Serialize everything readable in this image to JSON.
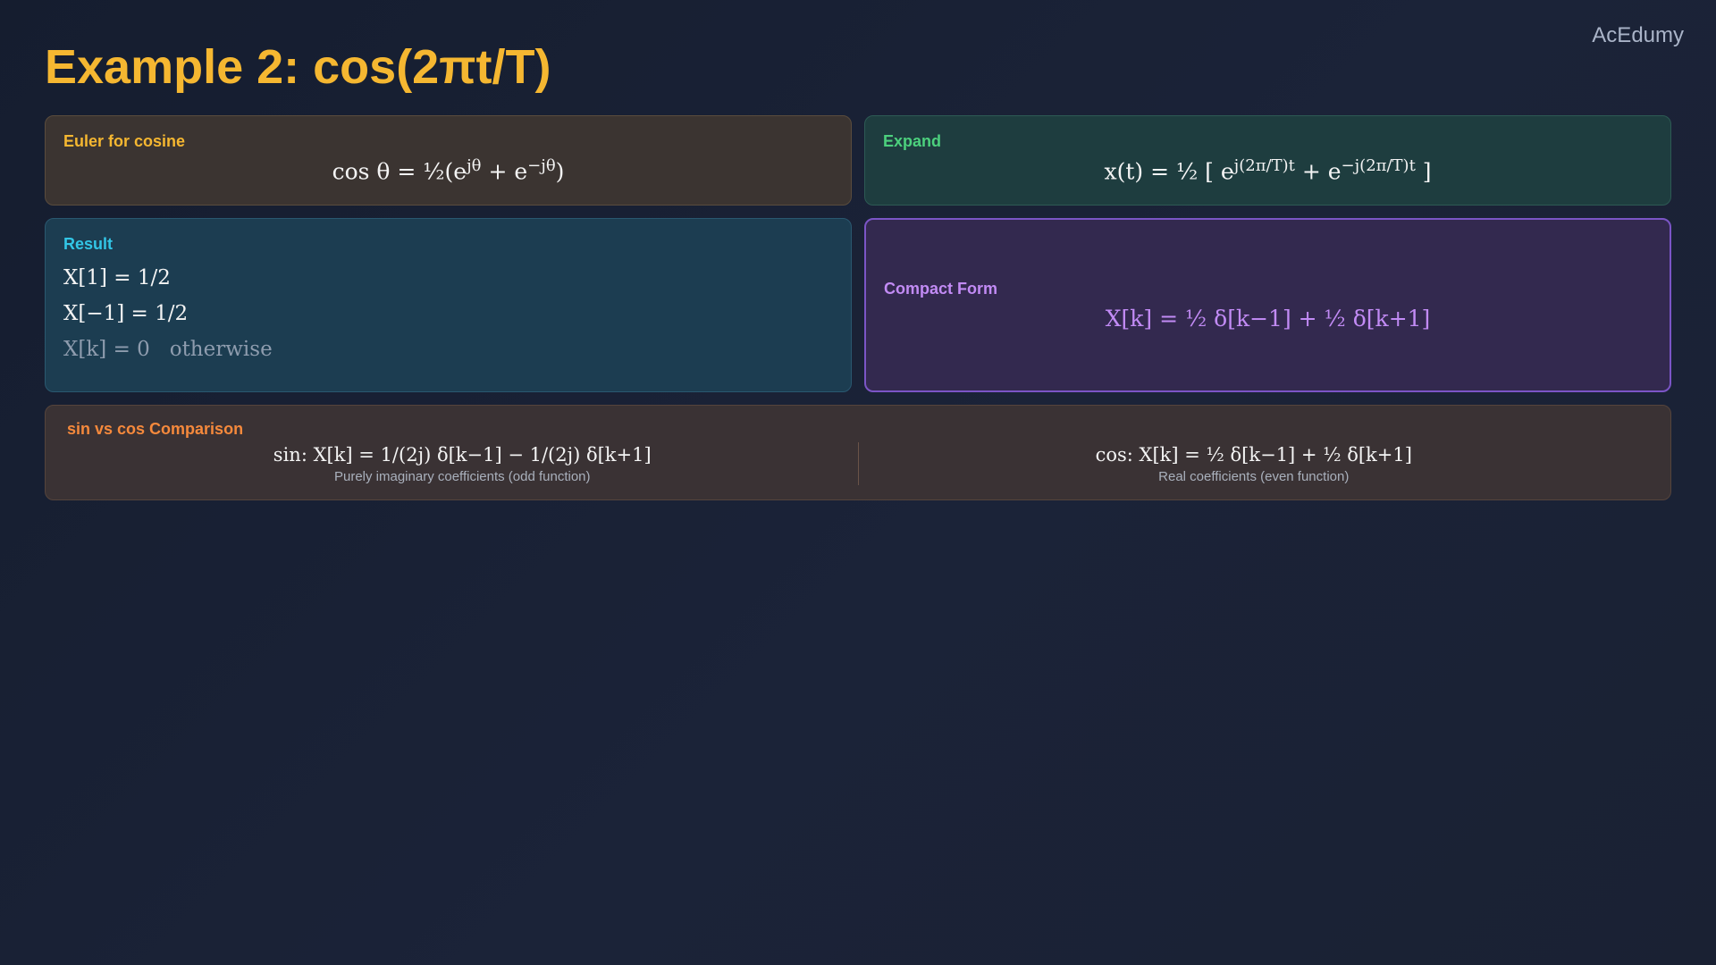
{
  "brand": "AcEdumy",
  "title": "Example 2: cos(2πt/T)",
  "euler": {
    "label": "Euler for cosine",
    "lhs": "cos θ = ½(e",
    "exp1": "jθ",
    "mid": " + e",
    "exp2": "−jθ",
    "end": ")"
  },
  "expand": {
    "label": "Expand",
    "lhs": "x(t) = ½ [ e",
    "exp1": "j(2π/T)t",
    "mid": " + e",
    "exp2": "−j(2π/T)t",
    "end": " ]"
  },
  "result": {
    "label": "Result",
    "lines": [
      "X[1] = 1/2",
      "X[−1] = 1/2",
      "X[k] = 0   otherwise"
    ]
  },
  "compact": {
    "label": "Compact Form",
    "equation": "X[k] = ½ δ[k−1] + ½ δ[k+1]"
  },
  "comparison": {
    "label": "sin vs cos Comparison",
    "sin": {
      "equation": "sin: X[k] = 1/(2j) δ[k−1] − 1/(2j) δ[k+1]",
      "note": "Purely imaginary coefficients (odd function)"
    },
    "cos": {
      "equation": "cos: X[k] = ½ δ[k−1] + ½ δ[k+1]",
      "note": "Real coefficients (even function)"
    }
  },
  "colors": {
    "title": "#f5b731",
    "euler_label": "#f5b731",
    "expand_label": "#4cd07d",
    "result_label": "#32c6e6",
    "compact_accent": "#c28bf5",
    "comparison_label": "#f5893c"
  }
}
